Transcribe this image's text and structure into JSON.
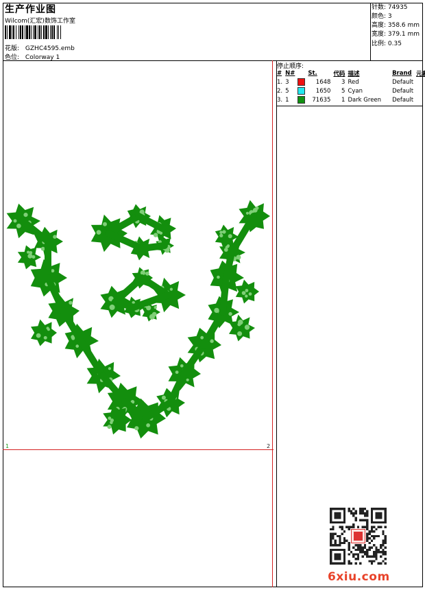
{
  "header": {
    "title": "生产作业图",
    "company": "Wilcom(汇宏)数饰工作室",
    "design_label": "花版:",
    "design_value": "GZHC4595.emb",
    "colorway_label": "色位:",
    "colorway_value": "Colorway 1"
  },
  "stats": {
    "stitches": "针数: 74935",
    "colors": "颜色: 3",
    "height": "高度: 358.6 mm",
    "width": "宽度: 379.1 mm",
    "scale": "比例: 0.35"
  },
  "stop_sequence": {
    "title": "停止顺序:",
    "headers": [
      "#",
      "N#",
      "St.",
      "代码",
      "描述",
      "Brand",
      "元素"
    ],
    "rows": [
      {
        "index": "1.",
        "needle": "3",
        "color": "#ee1111",
        "stitches": "1648",
        "code": "3",
        "desc": "Red",
        "brand": "Default"
      },
      {
        "index": "2.",
        "needle": "5",
        "color": "#22e8ee",
        "stitches": "1650",
        "code": "5",
        "desc": "Cyan",
        "brand": "Default"
      },
      {
        "index": "3.",
        "needle": "1",
        "color": "#119111",
        "stitches": "71635",
        "code": "1",
        "desc": "Dark Green",
        "brand": "Default"
      }
    ]
  },
  "markers": {
    "one": "1",
    "two": "2"
  },
  "watermark": "6xiu.com",
  "design_color": "#138e0d"
}
